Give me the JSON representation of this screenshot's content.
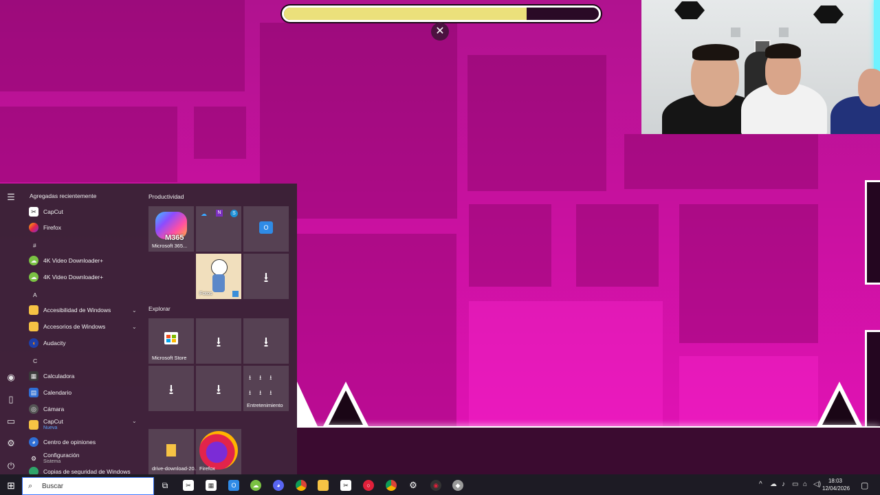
{
  "game": {
    "progress_percent": 77,
    "close_symbol": "✕"
  },
  "start_menu": {
    "recent_header": "Agregadas recientemente",
    "apps": [
      {
        "label": "CapCut",
        "icon": "capcut-icon"
      },
      {
        "label": "Firefox",
        "icon": "firefox-icon"
      },
      {
        "label": "#",
        "type": "letter"
      },
      {
        "label": "4K Video Downloader+",
        "icon": "4k-downloader-icon"
      },
      {
        "label": "4K Video Downloader+",
        "icon": "4k-downloader-icon"
      },
      {
        "label": "A",
        "type": "letter"
      },
      {
        "label": "Accesibilidad de Windows",
        "icon": "folder-icon",
        "expandable": true
      },
      {
        "label": "Accesorios de Windows",
        "icon": "folder-icon",
        "expandable": true
      },
      {
        "label": "Audacity",
        "icon": "audacity-icon"
      },
      {
        "label": "C",
        "type": "letter"
      },
      {
        "label": "Calculadora",
        "icon": "calculator-icon"
      },
      {
        "label": "Calendario",
        "icon": "calendar-icon"
      },
      {
        "label": "Cámara",
        "icon": "camera-icon"
      },
      {
        "label": "CapCut",
        "sub": "Nueva",
        "icon": "folder-icon",
        "expandable": true
      },
      {
        "label": "Centro de opiniones",
        "icon": "feedback-icon"
      },
      {
        "label": "Configuración",
        "sub": "Sistema",
        "icon": "gear-icon"
      },
      {
        "label": "Copias de seguridad de Windows",
        "icon": "backup-icon"
      }
    ],
    "groups": {
      "productivity": "Productividad",
      "explore": "Explorar"
    },
    "tiles": {
      "m365_label": "Microsoft 365...",
      "m365_badge": "M365",
      "fotos_label": "Fotos",
      "store_label": "Microsoft Store",
      "entertainment_label": "Entretenimiento",
      "drive_label": "drive-download-20...",
      "firefox_label": "Firefox"
    }
  },
  "taskbar": {
    "search_placeholder": "Buscar",
    "clock_time": "18:03",
    "clock_date": "12/04/2026"
  },
  "colors": {
    "progress_fill": "#ebe07b",
    "game_background": "#c0139f",
    "start_menu_bg": "#342432",
    "taskbar_bg": "#1d1b24"
  }
}
